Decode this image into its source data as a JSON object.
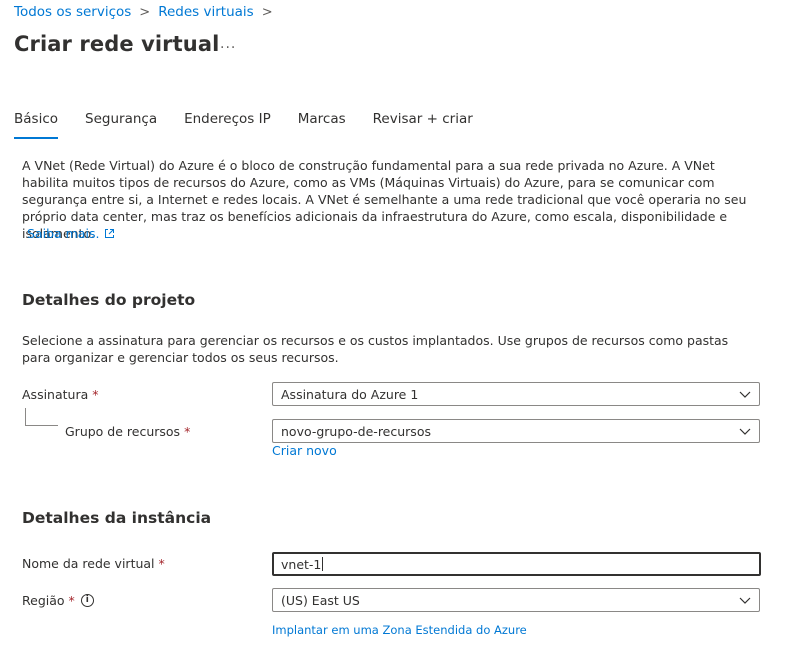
{
  "breadcrumb": {
    "items": [
      "Todos os serviços",
      "Redes virtuais"
    ],
    "separator": ">"
  },
  "page": {
    "title": "Criar rede virtual",
    "more_label": "..."
  },
  "tabs": [
    {
      "label": "Básico",
      "active": true
    },
    {
      "label": "Segurança",
      "active": false
    },
    {
      "label": "Endereços IP",
      "active": false
    },
    {
      "label": "Marcas",
      "active": false
    },
    {
      "label": "Revisar + criar",
      "active": false
    }
  ],
  "intro": {
    "text": "A VNet (Rede Virtual) do Azure é o bloco de construção fundamental para a sua rede privada no Azure. A VNet habilita muitos tipos de recursos do Azure, como as VMs (Máquinas Virtuais) do Azure, para se comunicar com segurança entre si, a Internet e redes locais. A VNet é semelhante a uma rede tradicional que você operaria no seu próprio data center, mas traz os benefícios adicionais da infraestrutura do Azure, como escala, disponibilidade e isolamento.",
    "learn_more": "Saiba mais."
  },
  "project": {
    "heading": "Detalhes do projeto",
    "description": "Selecione a assinatura para gerenciar os recursos e os custos implantados. Use grupos de recursos como pastas para organizar e gerenciar todos os seus recursos.",
    "subscription": {
      "label": "Assinatura",
      "required": "*",
      "value": "Assinatura do Azure 1"
    },
    "resource_group": {
      "label": "Grupo de recursos",
      "required": "*",
      "value": "novo-grupo-de-recursos",
      "create_new": "Criar novo"
    }
  },
  "instance": {
    "heading": "Detalhes da instância",
    "vnet_name": {
      "label": "Nome da rede virtual",
      "required": "*",
      "value": "vnet-1"
    },
    "region": {
      "label": "Região",
      "required": "*",
      "info": "i",
      "value": "(US) East US",
      "extended_zone_link": "Implantar em uma Zona Estendida do Azure"
    }
  },
  "colors": {
    "accent": "#0078d4",
    "required": "#a4262c",
    "text": "#323130",
    "border": "#8a8886"
  }
}
